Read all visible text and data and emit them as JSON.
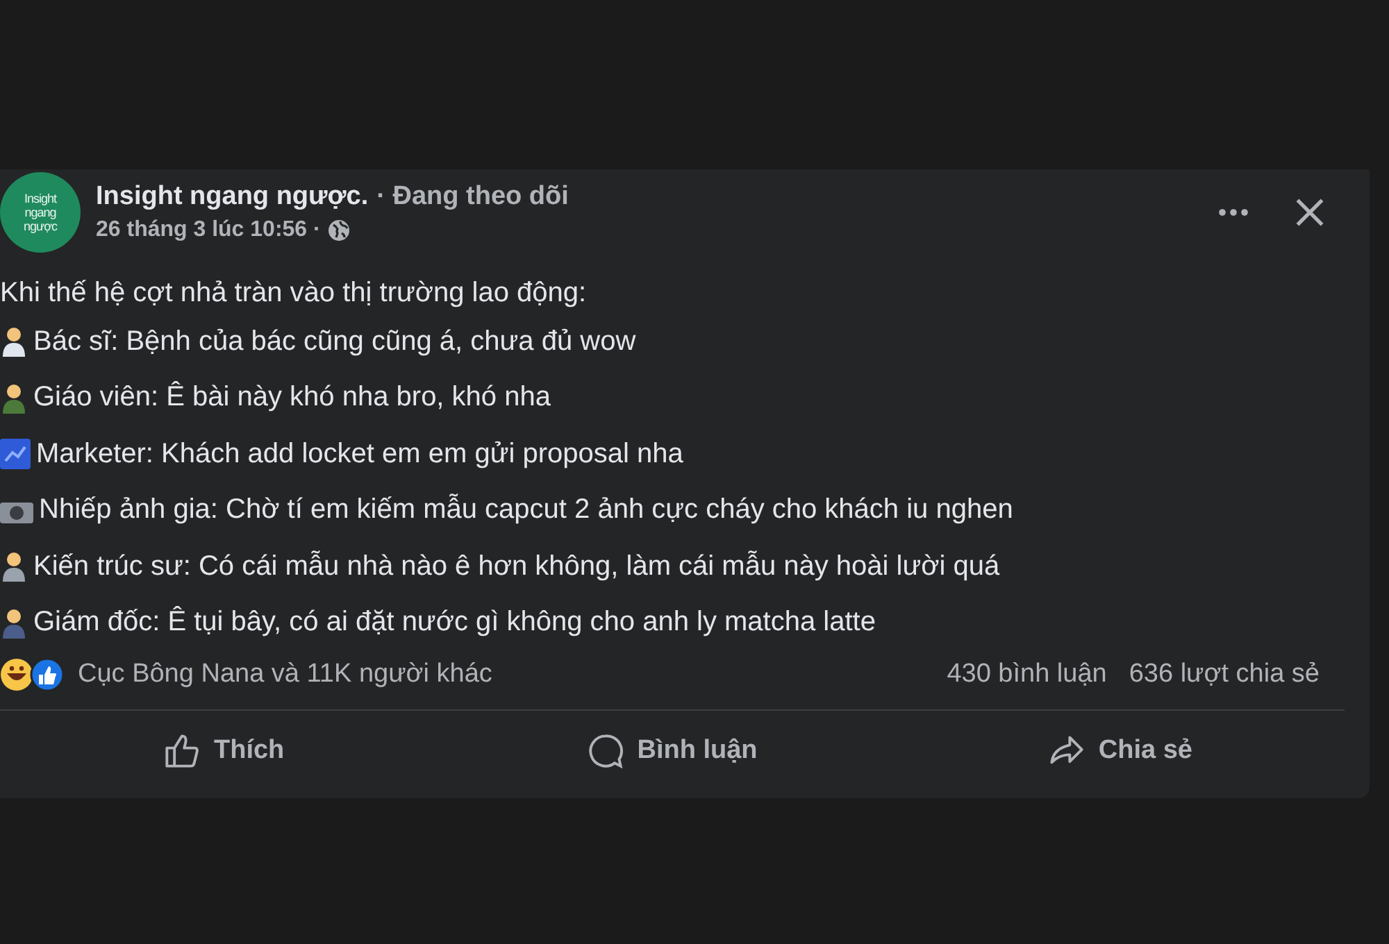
{
  "page": {
    "avatar_text": [
      "Insight",
      "ngang",
      "ngược"
    ],
    "name": "Insight ngang ngược.",
    "follow": "· Đang theo dõi",
    "time": "26 tháng 3 lúc 10:56 ·"
  },
  "post": {
    "intro": "Khi thế hệ cợt nhả tràn vào thị trường lao động:",
    "lines": [
      {
        "kind": "doctor",
        "text": "Bác sĩ: Bệnh của bác cũng cũng á, chưa đủ wow"
      },
      {
        "kind": "teacher",
        "text": "Giáo viên: Ê bài này khó nha bro, khó nha"
      },
      {
        "kind": "marketer",
        "text": "Marketer: Khách add locket em em gửi proposal nha"
      },
      {
        "kind": "camera",
        "text": "Nhiếp ảnh gia: Chờ tí em kiếm mẫu capcut 2 ảnh cực cháy cho khách iu nghen"
      },
      {
        "kind": "architect",
        "text": "Kiến trúc sư: Có cái mẫu nhà nào ê hơn không, làm cái mẫu này hoài lười quá"
      },
      {
        "kind": "boss",
        "text": "Giám đốc: Ê tụi bây, có ai đặt nước gì không cho anh ly matcha latte"
      }
    ]
  },
  "stats": {
    "reactions": "Cục Bông Nana và 11K người khác",
    "comments": "430 bình luận",
    "shares": "636 lượt chia sẻ"
  },
  "actions": [
    {
      "kind": "like",
      "label": "Thích"
    },
    {
      "kind": "comment",
      "label": "Bình luận"
    },
    {
      "kind": "share",
      "label": "Chia sẻ"
    }
  ]
}
